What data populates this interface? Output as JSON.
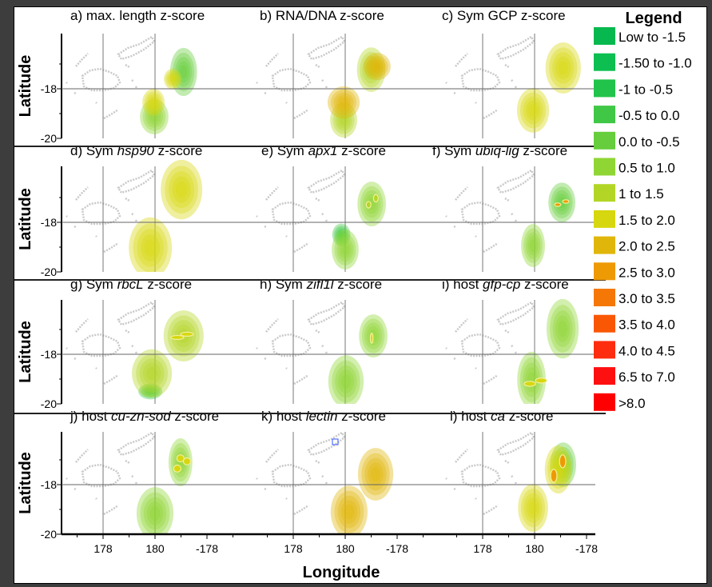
{
  "chart_data": {
    "type": "heatmap",
    "xlabel": "Longitude",
    "ylabel": "Latitude",
    "x_ticks": [
      "178",
      "180",
      "-178"
    ],
    "y_ticks": [
      "-18",
      "-20"
    ],
    "grid": true,
    "legend_position": "right",
    "legend": {
      "title": "Legend",
      "items": [
        {
          "label": "Low to -1.5",
          "color": "#07b84e"
        },
        {
          "label": "-1.50 to -1.0",
          "color": "#0cbf50"
        },
        {
          "label": "-1 to -0.5",
          "color": "#22c34a"
        },
        {
          "label": "-0.5 to 0.0",
          "color": "#40c746"
        },
        {
          "label": "0.0 to -0.5",
          "color": "#66cd3c"
        },
        {
          "label": "0.5 to 1.0",
          "color": "#8fd635"
        },
        {
          "label": "1 to 1.5",
          "color": "#b3d626"
        },
        {
          "label": "1.5 to 2.0",
          "color": "#d7d70f"
        },
        {
          "label": "2.0 to 2.5",
          "color": "#e0b60a"
        },
        {
          "label": "2.5 to 3.0",
          "color": "#ee9a05"
        },
        {
          "label": "3.0 to 3.5",
          "color": "#f57806"
        },
        {
          "label": "3.5 to 4.0",
          "color": "#fa5705"
        },
        {
          "label": "4.0 to 4.5",
          "color": "#ff2d0f"
        },
        {
          "label": "6.5 to 7.0",
          "color": "#ff1010"
        },
        {
          "label": ">8.0",
          "color": "#ff0000"
        }
      ]
    },
    "panels": [
      {
        "title": {
          "prefix": "a) max. length z-score",
          "gene": "",
          "suffix": ""
        },
        "hotspots": [
          {
            "lon": -178.9,
            "lat": -17.32,
            "rlon": 0.52,
            "rlat": 0.97,
            "level": 4
          },
          {
            "lon": -179.32,
            "lat": -17.61,
            "rlon": 0.34,
            "rlat": 0.42,
            "level": 7
          },
          {
            "lon": 179.97,
            "lat": -19.13,
            "rlon": 0.55,
            "rlat": 0.71,
            "level": 5
          },
          {
            "lon": 179.94,
            "lat": -18.55,
            "rlon": 0.43,
            "rlat": 0.55,
            "level": 7
          }
        ]
      },
      {
        "title": {
          "prefix": "b) RNA/DNA z-score",
          "gene": "",
          "suffix": ""
        },
        "hotspots": [
          {
            "lon": -179.0,
            "lat": -17.23,
            "rlon": 0.55,
            "rlat": 0.9,
            "level": 6
          },
          {
            "lon": -178.77,
            "lat": -17.1,
            "rlon": 0.52,
            "rlat": 0.55,
            "level": 8
          },
          {
            "lon": 179.94,
            "lat": -19.26,
            "rlon": 0.52,
            "rlat": 0.71,
            "level": 6
          },
          {
            "lon": 179.94,
            "lat": -18.55,
            "rlon": 0.62,
            "rlat": 0.65,
            "level": 8
          }
        ]
      },
      {
        "title": {
          "prefix": "c) Sym GCP z-score",
          "gene": "",
          "suffix": ""
        },
        "hotspots": [
          {
            "lon": -178.9,
            "lat": -17.16,
            "rlon": 0.68,
            "rlat": 1.03,
            "level": 7
          },
          {
            "lon": 179.94,
            "lat": -18.87,
            "rlon": 0.62,
            "rlat": 0.9,
            "level": 7
          }
        ]
      },
      {
        "title": {
          "prefix": "d) Sym ",
          "gene": "hsp90",
          "suffix": " z-score"
        },
        "hotspots": [
          {
            "lon": -178.98,
            "lat": -16.68,
            "rlon": 0.8,
            "rlat": 1.2,
            "level": 7
          },
          {
            "lon": 179.82,
            "lat": -19.03,
            "rlon": 0.83,
            "rlat": 1.23,
            "level": 7
          }
        ]
      },
      {
        "title": {
          "prefix": "e) Sym ",
          "gene": "apx1",
          "suffix": " z-score"
        },
        "hotspots": [
          {
            "lon": -178.98,
            "lat": -17.26,
            "rlon": 0.55,
            "rlat": 0.9,
            "level": 5
          },
          {
            "lon": 179.85,
            "lat": -18.5,
            "rlon": 0.35,
            "rlat": 0.45,
            "level": 3
          },
          {
            "lon": 180.0,
            "lat": -19.1,
            "rlon": 0.52,
            "rlat": 0.8,
            "level": 5
          },
          {
            "lon": -179.1,
            "lat": -17.29,
            "rlon": 0.09,
            "rlat": 0.13,
            "level": 6
          },
          {
            "lon": -178.82,
            "lat": -17.03,
            "rlon": 0.09,
            "rlat": 0.15,
            "level": 6
          }
        ]
      },
      {
        "title": {
          "prefix": "f) Sym ",
          "gene": "ubiq-lig",
          "suffix": " z-score"
        },
        "hotspots": [
          {
            "lon": -178.95,
            "lat": -17.2,
            "rlon": 0.52,
            "rlat": 0.8,
            "level": 4
          },
          {
            "lon": 179.94,
            "lat": -18.94,
            "rlon": 0.46,
            "rlat": 0.87,
            "level": 5
          },
          {
            "lon": -179.11,
            "lat": -17.29,
            "rlon": 0.12,
            "rlat": 0.07,
            "level": 9
          },
          {
            "lon": -178.8,
            "lat": -17.16,
            "rlon": 0.12,
            "rlat": 0.07,
            "level": 9
          }
        ]
      },
      {
        "title": {
          "prefix": "g) Sym ",
          "gene": "rbcL",
          "suffix": " z-score"
        },
        "hotspots": [
          {
            "lon": 179.82,
            "lat": -19.5,
            "rlon": 0.46,
            "rlat": 0.32,
            "level": 3
          },
          {
            "lon": -178.9,
            "lat": -17.26,
            "rlon": 0.77,
            "rlat": 1.03,
            "level": 6
          },
          {
            "lon": 179.88,
            "lat": -18.77,
            "rlon": 0.77,
            "rlat": 0.97,
            "level": 6
          },
          {
            "lon": -179.14,
            "lat": -17.32,
            "rlon": 0.25,
            "rlat": 0.08,
            "level": 7
          },
          {
            "lon": -178.77,
            "lat": -17.19,
            "rlon": 0.25,
            "rlat": 0.08,
            "level": 7
          }
        ]
      },
      {
        "title": {
          "prefix": "h) Sym ",
          "gene": "zifl1l",
          "suffix": " z-score"
        },
        "hotspots": [
          {
            "lon": -178.92,
            "lat": -17.26,
            "rlon": 0.55,
            "rlat": 0.87,
            "level": 5
          },
          {
            "lon": -179.97,
            "lat": -19.1,
            "rlon": 0.68,
            "rlat": 1.06,
            "level": 5
          },
          {
            "lon": -178.98,
            "lat": -17.35,
            "rlon": 0.05,
            "rlat": 0.2,
            "level": 7
          }
        ]
      },
      {
        "title": {
          "prefix": "i) host ",
          "gene": "gfp-cp",
          "suffix": " z-score"
        },
        "hotspots": [
          {
            "lon": -178.92,
            "lat": -16.97,
            "rlon": 0.62,
            "rlat": 1.2,
            "level": 5
          },
          {
            "lon": 179.88,
            "lat": -19.03,
            "rlon": 0.55,
            "rlat": 1.13,
            "level": 5
          },
          {
            "lon": 179.82,
            "lat": -19.19,
            "rlon": 0.22,
            "rlat": 0.1,
            "level": 7
          },
          {
            "lon": -179.75,
            "lat": -19.06,
            "rlon": 0.22,
            "rlat": 0.1,
            "level": 7
          }
        ]
      },
      {
        "title": {
          "prefix": "j) host ",
          "gene": "cu-zn-sod",
          "suffix": " z-score"
        },
        "hotspots": [
          {
            "lon": -179.02,
            "lat": -17.1,
            "rlon": 0.46,
            "rlat": 0.97,
            "level": 5
          },
          {
            "lon": 180.0,
            "lat": -19.16,
            "rlon": 0.71,
            "rlat": 1.06,
            "level": 5
          },
          {
            "lon": -179.02,
            "lat": -16.94,
            "rlon": 0.14,
            "rlat": 0.14,
            "level": 7
          },
          {
            "lon": -178.77,
            "lat": -17.06,
            "rlon": 0.14,
            "rlat": 0.14,
            "level": 7
          },
          {
            "lon": -179.14,
            "lat": -17.35,
            "rlon": 0.14,
            "rlat": 0.14,
            "level": 7
          }
        ]
      },
      {
        "title": {
          "prefix": "k) host ",
          "gene": "lectin",
          "suffix": " z-score"
        },
        "hotspots": [
          {
            "lon": -178.83,
            "lat": -17.58,
            "rlon": 0.68,
            "rlat": 1.06,
            "level": 8
          },
          {
            "lon": -179.85,
            "lat": -19.1,
            "rlon": 0.71,
            "rlat": 1.06,
            "level": 8
          }
        ]
      },
      {
        "title": {
          "prefix": "l) host ",
          "gene": "ca",
          "suffix": " z-score"
        },
        "hotspots": [
          {
            "lon": -178.9,
            "lat": -17.2,
            "rlon": 0.5,
            "rlat": 0.9,
            "level": 4
          },
          {
            "lon": -179.09,
            "lat": -17.39,
            "rlon": 0.52,
            "rlat": 0.97,
            "level": 7
          },
          {
            "lon": 179.94,
            "lat": -18.94,
            "rlon": 0.58,
            "rlat": 0.97,
            "level": 7
          },
          {
            "lon": -178.92,
            "lat": -17.06,
            "rlon": 0.12,
            "rlat": 0.26,
            "level": 9
          },
          {
            "lon": -179.26,
            "lat": -17.64,
            "rlon": 0.12,
            "rlat": 0.26,
            "level": 9
          }
        ]
      }
    ]
  }
}
